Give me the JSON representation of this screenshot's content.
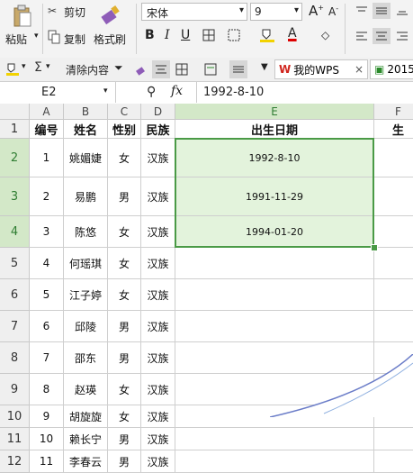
{
  "ribbon": {
    "paste_label": "粘贴",
    "cut_label": "剪切",
    "copy_label": "复制",
    "format_painter_label": "格式刷",
    "font_name": "宋体",
    "font_size": "9",
    "bold": "B",
    "italic": "I",
    "underline": "U",
    "font_color_glyph": "A"
  },
  "toolbar2": {
    "clear_label": "清除内容",
    "tab1_label": "我的WPS",
    "tab2_label": "2015"
  },
  "formula_bar": {
    "name_box": "E2",
    "fx_label": "fx",
    "formula": "1992-8-10"
  },
  "sheet": {
    "columns": [
      "A",
      "B",
      "C",
      "D",
      "E",
      "F"
    ],
    "row_numbers": [
      "1",
      "2",
      "3",
      "4",
      "5",
      "6",
      "7",
      "8",
      "9",
      "10",
      "11",
      "12"
    ],
    "header_row": [
      "编号",
      "姓名",
      "性别",
      "民族",
      "出生日期",
      "生"
    ],
    "rows": [
      [
        "1",
        "姚媚婕",
        "女",
        "汉族",
        "1992-8-10"
      ],
      [
        "2",
        "易鹏",
        "男",
        "汉族",
        "1991-11-29"
      ],
      [
        "3",
        "陈悠",
        "女",
        "汉族",
        "1994-01-20"
      ],
      [
        "4",
        "何瑶琪",
        "女",
        "汉族",
        ""
      ],
      [
        "5",
        "江子婷",
        "女",
        "汉族",
        ""
      ],
      [
        "6",
        "邱陵",
        "男",
        "汉族",
        ""
      ],
      [
        "7",
        "邵东",
        "男",
        "汉族",
        ""
      ],
      [
        "8",
        "赵瑛",
        "女",
        "汉族",
        ""
      ],
      [
        "9",
        "胡旋旋",
        "女",
        "汉族",
        ""
      ],
      [
        "10",
        "赖长宁",
        "男",
        "汉族",
        ""
      ],
      [
        "11",
        "李春云",
        "男",
        "汉族",
        ""
      ]
    ],
    "selected_range": "E2:E4",
    "colors": {
      "selection_fill": "#e3f3dc",
      "selection_border": "#4a9a46",
      "header_bg": "#efefef"
    }
  }
}
